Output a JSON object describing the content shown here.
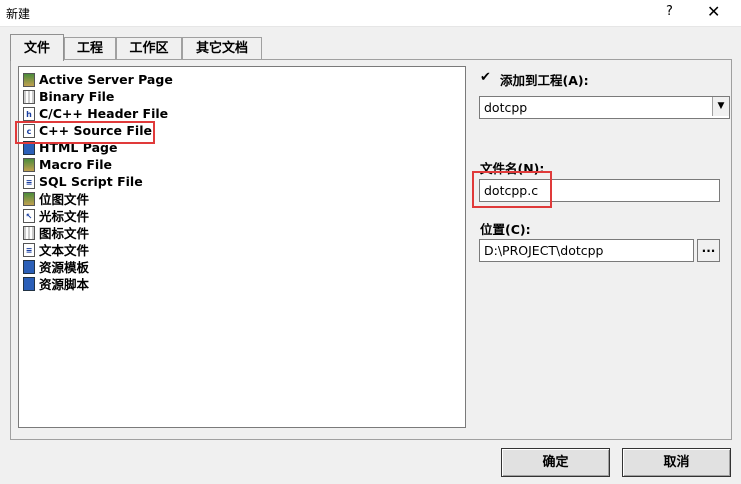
{
  "window": {
    "title": "新建",
    "help": "?",
    "close": "✕"
  },
  "tabs": [
    {
      "label": "文件"
    },
    {
      "label": "工程"
    },
    {
      "label": "工作区"
    },
    {
      "label": "其它文档"
    }
  ],
  "file_types": [
    {
      "label": "Active Server Page",
      "icon": "asp-icon"
    },
    {
      "label": "Binary File",
      "icon": "binary-icon"
    },
    {
      "label": "C/C++ Header File",
      "icon": "header-file-icon"
    },
    {
      "label": "C++ Source File",
      "icon": "source-file-icon"
    },
    {
      "label": "HTML Page",
      "icon": "html-icon"
    },
    {
      "label": "Macro File",
      "icon": "macro-icon"
    },
    {
      "label": "SQL Script File",
      "icon": "sql-icon"
    },
    {
      "label": "位图文件",
      "icon": "bitmap-icon"
    },
    {
      "label": "光标文件",
      "icon": "cursor-icon"
    },
    {
      "label": "图标文件",
      "icon": "icon-file-icon"
    },
    {
      "label": "文本文件",
      "icon": "text-file-icon"
    },
    {
      "label": "资源模板",
      "icon": "resource-template-icon"
    },
    {
      "label": "资源脚本",
      "icon": "resource-script-icon"
    }
  ],
  "add_to_project": {
    "label": "添加到工程(A):",
    "checked": "✔"
  },
  "project_combo": {
    "value": "dotcpp",
    "arrow": "▼"
  },
  "filename": {
    "label": "文件名(N):",
    "value": "dotcpp.c"
  },
  "location": {
    "label": "位置(C):",
    "value": "D:\\PROJECT\\dotcpp",
    "browse": "..."
  },
  "buttons": {
    "ok": "确定",
    "cancel": "取消"
  }
}
